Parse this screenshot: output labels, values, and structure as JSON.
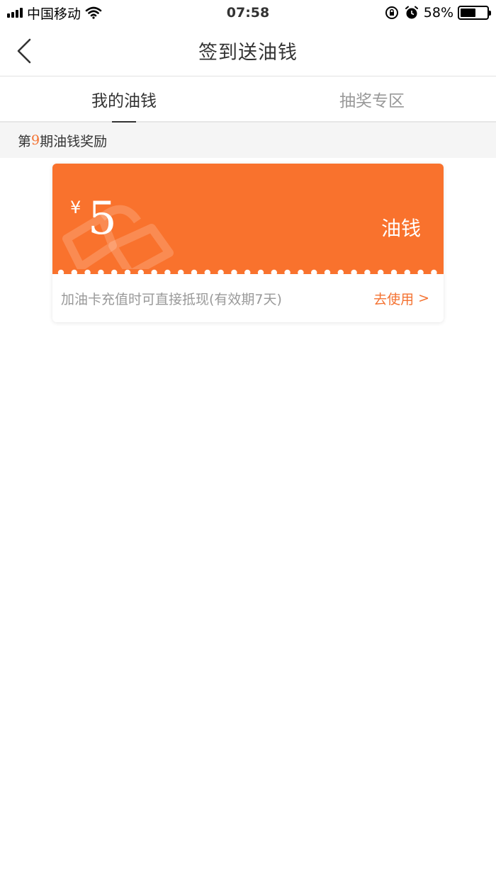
{
  "status_bar": {
    "carrier": "中国移动",
    "time": "07:58",
    "battery": "58%",
    "battery_level": 0.58
  },
  "nav": {
    "title": "签到送油钱"
  },
  "tabs": [
    {
      "label": "我的油钱",
      "active": true
    },
    {
      "label": "抽奖专区",
      "active": false
    }
  ],
  "period": {
    "prefix": "第",
    "number": "9",
    "suffix": "期油钱奖励"
  },
  "coupon": {
    "currency": "¥",
    "amount": "5",
    "unit": "油钱",
    "description": "加油卡充值时可直接抵现(有效期7天)",
    "action_label": "去使用",
    "action_chevron": ">"
  },
  "colors": {
    "accent": "#f9722d",
    "accent_text": "#f47231"
  },
  "icons": [
    "back-chevron-icon",
    "wifi-icon",
    "rotation-lock-icon",
    "alarm-icon",
    "battery-icon",
    "gift-watermark-icon"
  ]
}
